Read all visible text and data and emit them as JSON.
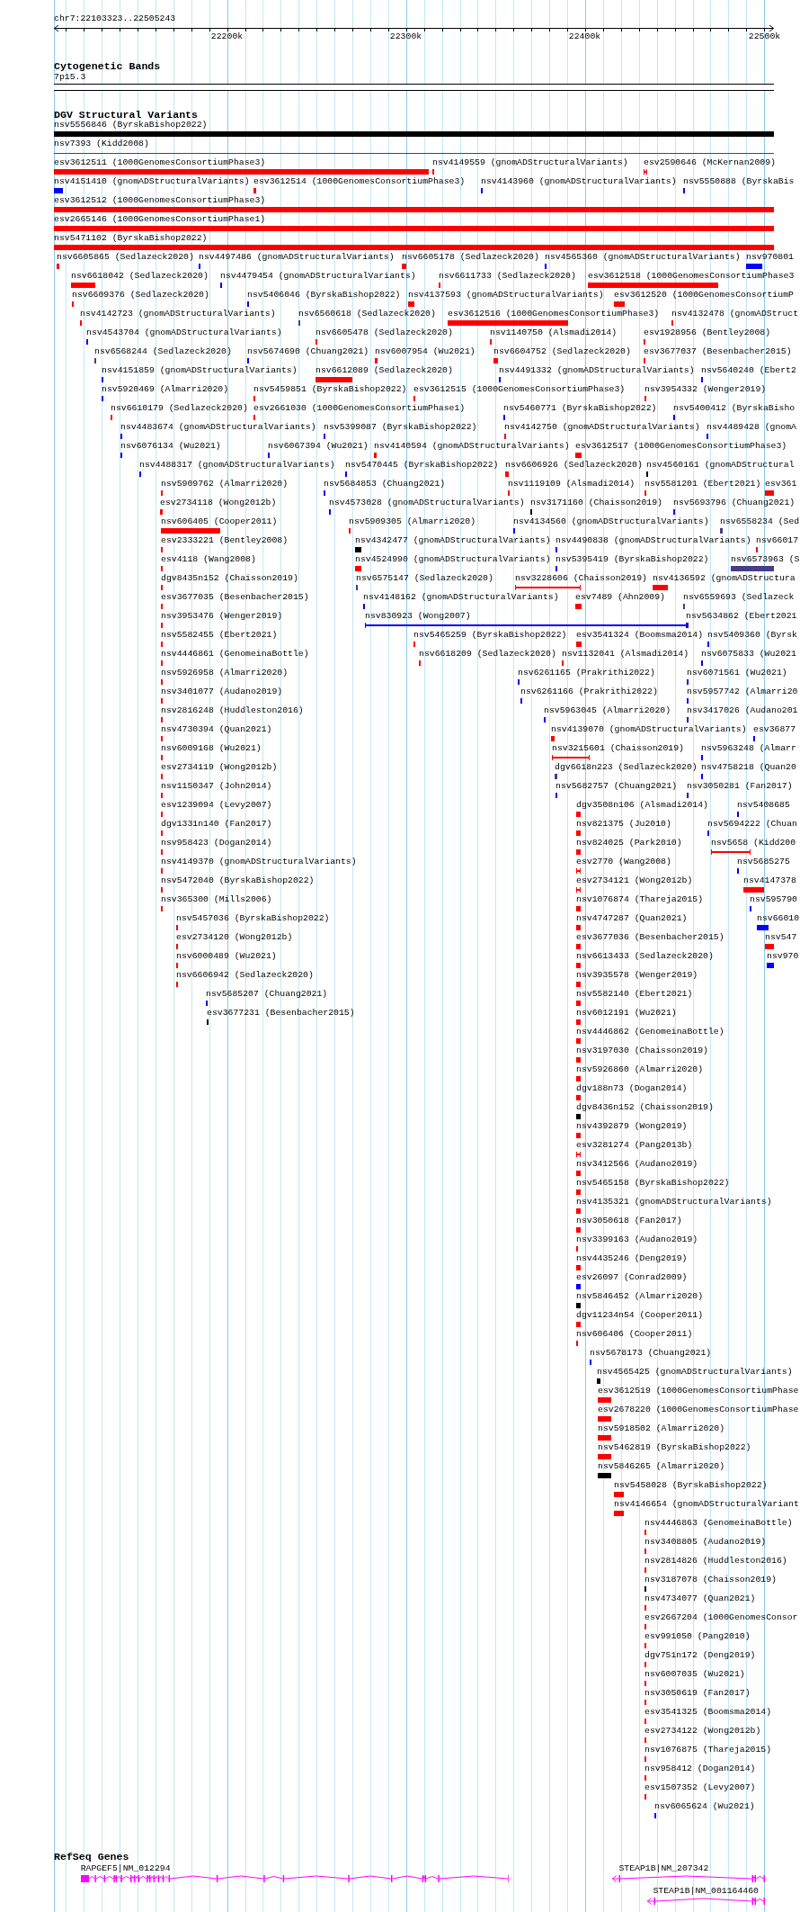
{
  "ruler": {
    "region": "chr7:22103323..22505243",
    "ticks": [
      "22200k",
      "22300k",
      "22400k",
      "22500k"
    ]
  },
  "cytogenetic_bands": {
    "title": "Cytogenetic Bands",
    "bands": [
      {
        "label": "7p15.3"
      }
    ]
  },
  "structural_variants": {
    "title": "DGV Structural Variants",
    "rows": [
      {
        "features": [
          {
            "label": "nsv5556846 (ByrskaBishop2022)",
            "color": "#000000",
            "kind": "block"
          }
        ]
      },
      {
        "features": [
          {
            "label": "nsv7393 (Kidd2008)",
            "color": "#483d8b",
            "kind": "line"
          }
        ]
      },
      {
        "features": [
          {
            "label": "esv3612511 (1000GenomesConsortiumPhase3)",
            "color": "#ff0000",
            "kind": "block"
          },
          {
            "label": "nsv4149559 (gnomADStructuralVariants)",
            "color": "#ff0000",
            "kind": "block"
          },
          {
            "label": "esv2590646 (McKernan2009)",
            "color": "#ff0000",
            "kind": "span"
          }
        ]
      },
      {
        "features": [
          {
            "label": "nsv4151410 (gnomADStructuralVariants)",
            "color": "#0000ff",
            "kind": "block"
          },
          {
            "label": "esv3612514 (1000GenomesConsortiumPhase3)",
            "color": "#ff0000",
            "kind": "block"
          },
          {
            "label": "nsv4143960 (gnomADStructuralVariants)",
            "color": "#0000ff",
            "kind": "block"
          },
          {
            "label": "nsv5550888 (ByrskaBis",
            "color": "#0000ff",
            "kind": "block"
          }
        ]
      },
      {
        "features": [
          {
            "label": "esv3612512 (1000GenomesConsortiumPhase3)",
            "color": "#ff0000",
            "kind": "block"
          }
        ]
      },
      {
        "features": [
          {
            "label": "esv2665146 (1000GenomesConsortiumPhase1)",
            "color": "#ff0000",
            "kind": "block"
          }
        ]
      },
      {
        "features": [
          {
            "label": "nsv5471102 (ByrskaBishop2022)",
            "color": "#ff0000",
            "kind": "block"
          }
        ]
      },
      {
        "features": [
          {
            "label": "nsv6605865 (Sedlazeck2020)",
            "color": "#ff0000",
            "kind": "block"
          },
          {
            "label": "nsv4497486 (gnomADStructuralVariants)",
            "color": "#0000ff",
            "kind": "block"
          },
          {
            "label": "nsv6605178 (Sedlazeck2020)",
            "color": "#ff0000",
            "kind": "block"
          },
          {
            "label": "nsv4565360 (gnomADStructuralVariants)",
            "color": "#0000ff",
            "kind": "block"
          },
          {
            "label": "nsv970801",
            "color": "#0000ff",
            "kind": "block"
          }
        ]
      },
      {
        "features": [
          {
            "label": "nsv6618042 (Sedlazeck2020)",
            "color": "#ff0000",
            "kind": "block"
          },
          {
            "label": "nsv4479454 (gnomADStructuralVariants)",
            "color": "#0000ff",
            "kind": "block"
          },
          {
            "label": "nsv6611733 (Sedlazeck2020)",
            "color": "#ff0000",
            "kind": "block"
          },
          {
            "label": "esv3612518 (1000GenomesConsortiumPhase3",
            "color": "#ff0000",
            "kind": "block"
          }
        ]
      },
      {
        "features": [
          {
            "label": "nsv6609376 (Sedlazeck2020)",
            "color": "#ff0000",
            "kind": "block"
          },
          {
            "label": "nsv5406046 (ByrskaBishop2022)",
            "color": "#0000ff",
            "kind": "block"
          },
          {
            "label": "nsv4137593 (gnomADStructuralVariants)",
            "color": "#ff0000",
            "kind": "block"
          },
          {
            "label": "esv3612520 (1000GenomesConsortiumP",
            "color": "#ff0000",
            "kind": "block"
          }
        ]
      },
      {
        "features": [
          {
            "label": "nsv4142723 (gnomADStructuralVariants)",
            "color": "#ff0000",
            "kind": "block"
          },
          {
            "label": "nsv6560618 (Sedlazeck2020)",
            "color": "#483d8b",
            "kind": "block"
          },
          {
            "label": "esv3612516 (1000GenomesConsortiumPhase3)",
            "color": "#ff0000",
            "kind": "block"
          },
          {
            "label": "nsv4132478 (gnomADStruct",
            "color": "#ff0000",
            "kind": "block"
          }
        ]
      },
      {
        "features": [
          {
            "label": "nsv4543704 (gnomADStructuralVariants)",
            "color": "#0000ff",
            "kind": "block"
          },
          {
            "label": "nsv6605478 (Sedlazeck2020)",
            "color": "#ff0000",
            "kind": "block"
          },
          {
            "label": "nsv1140750 (Alsmadi2014)",
            "color": "#ff0000",
            "kind": "block"
          },
          {
            "label": "esv1928956 (Bentley2008)",
            "color": "#ff0000",
            "kind": "block"
          }
        ]
      },
      {
        "features": [
          {
            "label": "nsv6568244 (Sedlazeck2020)",
            "color": "#483d8b",
            "kind": "block"
          },
          {
            "label": "nsv5674690 (Chuang2021)",
            "color": "#0000ff",
            "kind": "block"
          },
          {
            "label": "nsv6007954 (Wu2021)",
            "color": "#ff0000",
            "kind": "block"
          },
          {
            "label": "nsv6604752 (Sedlazeck2020)",
            "color": "#ff0000",
            "kind": "block"
          },
          {
            "label": "esv3677037 (Besenbacher2015)",
            "color": "#ff0000",
            "kind": "block"
          }
        ]
      },
      {
        "features": [
          {
            "label": "nsv4151859 (gnomADStructuralVariants)",
            "color": "#0000ff",
            "kind": "block"
          },
          {
            "label": "nsv6612089 (Sedlazeck2020)",
            "color": "#ff0000",
            "kind": "block"
          },
          {
            "label": "nsv4491332 (gnomADStructuralVariants)",
            "color": "#0000ff",
            "kind": "block"
          },
          {
            "label": "nsv5640240 (Ebert2",
            "color": "#0000ff",
            "kind": "block"
          }
        ]
      },
      {
        "features": [
          {
            "label": "nsv5920469 (Almarri2020)",
            "color": "#0000ff",
            "kind": "block"
          },
          {
            "label": "nsv5459851 (ByrskaBishop2022)",
            "color": "#ff0000",
            "kind": "block"
          },
          {
            "label": "esv3612515 (1000GenomesConsortiumPhase3)",
            "color": "#ff0000",
            "kind": "block"
          },
          {
            "label": "nsv3954332 (Wenger2019)",
            "color": "#ff0000",
            "kind": "block"
          }
        ]
      },
      {
        "features": [
          {
            "label": "nsv6610179 (Sedlazeck2020)",
            "color": "#ff0000",
            "kind": "block"
          },
          {
            "label": "esv2661030 (1000GenomesConsortiumPhase1)",
            "color": "#ff0000",
            "kind": "block"
          },
          {
            "label": "nsv5460771 (ByrskaBishop2022)",
            "color": "#0000ff",
            "kind": "block"
          },
          {
            "label": "nsv5400412 (ByrskaBisho",
            "color": "#0000ff",
            "kind": "block"
          }
        ]
      },
      {
        "features": [
          {
            "label": "nsv4483674 (gnomADStructuralVariants)",
            "color": "#0000ff",
            "kind": "block"
          },
          {
            "label": "nsv5399087 (ByrskaBishop2022)",
            "color": "#0000ff",
            "kind": "block"
          },
          {
            "label": "nsv4142750 (gnomADStructuralVariants)",
            "color": "#ff0000",
            "kind": "block"
          },
          {
            "label": "nsv4489428 (gnomA",
            "color": "#0000ff",
            "kind": "block"
          }
        ]
      },
      {
        "features": [
          {
            "label": "nsv6076134 (Wu2021)",
            "color": "#0000ff",
            "kind": "block"
          },
          {
            "label": "nsv6067394 (Wu2021)",
            "color": "#0000ff",
            "kind": "block"
          },
          {
            "label": "nsv4140594 (gnomADStructuralVariants)",
            "color": "#ff0000",
            "kind": "block"
          },
          {
            "label": "esv3612517 (1000GenomesConsortiumPhase3)",
            "color": "#ff0000",
            "kind": "block"
          }
        ]
      },
      {
        "features": [
          {
            "label": "nsv4488317 (gnomADStructuralVariants)",
            "color": "#0000ff",
            "kind": "block"
          },
          {
            "label": "nsv5470445 (ByrskaBishop2022)",
            "color": "#0000ff",
            "kind": "block"
          },
          {
            "label": "nsv6606926 (Sedlazeck2020)",
            "color": "#ff0000",
            "kind": "block"
          },
          {
            "label": "nsv4560161 (gnomADStructural",
            "color": "#000000",
            "kind": "block"
          }
        ]
      },
      {
        "features": [
          {
            "label": "nsv5909762 (Almarri2020)",
            "color": "#ff0000",
            "kind": "block"
          },
          {
            "label": "nsv5684853 (Chuang2021)",
            "color": "#0000ff",
            "kind": "block"
          },
          {
            "label": "nsv1119109 (Alsmadi2014)",
            "color": "#ff0000",
            "kind": "block"
          },
          {
            "label": "nsv5581201 (Ebert2021)",
            "color": "#ff0000",
            "kind": "block"
          },
          {
            "label": "esv361",
            "color": "#ff0000",
            "kind": "block"
          }
        ]
      },
      {
        "features": [
          {
            "label": "esv2734118 (Wong2012b)",
            "color": "#ff0000",
            "kind": "block"
          },
          {
            "label": "nsv4573028 (gnomADStructuralVariants)",
            "color": "#0000ff",
            "kind": "block"
          },
          {
            "label": "nsv3171160 (Chaisson2019)",
            "color": "#000000",
            "kind": "block"
          },
          {
            "label": "nsv5693796 (Chuang2021)",
            "color": "#0000ff",
            "kind": "block"
          }
        ]
      },
      {
        "features": [
          {
            "label": "nsv606405 (Cooper2011)",
            "color": "#ff0000",
            "kind": "block"
          },
          {
            "label": "nsv5909305 (Almarri2020)",
            "color": "#ff0000",
            "kind": "block"
          },
          {
            "label": "nsv4134560 (gnomADStructuralVariants)",
            "color": "#0000ff",
            "kind": "block"
          },
          {
            "label": "nsv6558234 (Sed",
            "color": "#483d8b",
            "kind": "block"
          }
        ]
      },
      {
        "features": [
          {
            "label": "esv2333221 (Bentley2008)",
            "color": "#ff0000",
            "kind": "block"
          },
          {
            "label": "nsv4342477 (gnomADStructuralVariants)",
            "color": "#000000",
            "kind": "block"
          },
          {
            "label": "nsv4490838 (gnomADStructuralVariants)",
            "color": "#0000ff",
            "kind": "block"
          },
          {
            "label": "nsv66017",
            "color": "#ff0000",
            "kind": "block"
          }
        ]
      },
      {
        "features": [
          {
            "label": "esv4118 (Wang2008)",
            "color": "#ff0000",
            "kind": "block"
          },
          {
            "label": "nsv4524990 (gnomADStructuralVariants)",
            "color": "#ff0000",
            "kind": "block"
          },
          {
            "label": "nsv5395419 (ByrskaBishop2022)",
            "color": "#0000ff",
            "kind": "block"
          },
          {
            "label": "nsv6573963 (S",
            "color": "#483d8b",
            "kind": "block"
          }
        ]
      },
      {
        "features": [
          {
            "label": "dgv8435n152 (Chaisson2019)",
            "color": "#ff0000",
            "kind": "block"
          },
          {
            "label": "nsv6575147 (Sedlazeck2020)",
            "color": "#483d8b",
            "kind": "block"
          },
          {
            "label": "nsv3228606 (Chaisson2019)",
            "color": "#ff0000",
            "kind": "span"
          },
          {
            "label": "nsv4136592 (gnomADStructura",
            "color": "#ff0000",
            "kind": "block"
          }
        ]
      },
      {
        "features": [
          {
            "label": "esv3677035 (Besenbacher2015)",
            "color": "#ff0000",
            "kind": "block"
          },
          {
            "label": "nsv4148162 (gnomADStructuralVariants)",
            "color": "#0000ff",
            "kind": "block"
          },
          {
            "label": "esv7489 (Ahn2009)",
            "color": "#ff0000",
            "kind": "block"
          },
          {
            "label": "nsv6559693 (Sedlazeck",
            "color": "#483d8b",
            "kind": "block"
          }
        ]
      },
      {
        "features": [
          {
            "label": "nsv3953476 (Wenger2019)",
            "color": "#ff0000",
            "kind": "block"
          },
          {
            "label": "nsv830923 (Wong2007)",
            "color": "#0000ff",
            "kind": "span"
          },
          {
            "label": "nsv5634862 (Ebert2021",
            "color": "#0000ff",
            "kind": "block"
          }
        ]
      },
      {
        "features": [
          {
            "label": "nsv5582455 (Ebert2021)",
            "color": "#ff0000",
            "kind": "block"
          },
          {
            "label": "nsv5465259 (ByrskaBishop2022)",
            "color": "#ff0000",
            "kind": "block"
          },
          {
            "label": "esv3541324 (Boomsma2014)",
            "color": "#ff0000",
            "kind": "block"
          },
          {
            "label": "nsv5409360 (Byrsk",
            "color": "#0000ff",
            "kind": "block"
          }
        ]
      },
      {
        "features": [
          {
            "label": "nsv4446861 (GenomeinaBottle)",
            "color": "#ff0000",
            "kind": "block"
          },
          {
            "label": "nsv6618209 (Sedlazeck2020)",
            "color": "#ff0000",
            "kind": "block"
          },
          {
            "label": "nsv1132041 (Alsmadi2014)",
            "color": "#ff0000",
            "kind": "block"
          },
          {
            "label": "nsv6075833 (Wu2021",
            "color": "#0000ff",
            "kind": "block"
          }
        ]
      },
      {
        "features": [
          {
            "label": "nsv5926958 (Almarri2020)",
            "color": "#ff0000",
            "kind": "block"
          },
          {
            "label": "nsv6261165 (Prakrithi2022)",
            "color": "#0000ff",
            "kind": "block"
          },
          {
            "label": "nsv6071561 (Wu2021)",
            "color": "#0000ff",
            "kind": "block"
          }
        ]
      },
      {
        "features": [
          {
            "label": "nsv3401077 (Audano2019)",
            "color": "#ff0000",
            "kind": "block"
          },
          {
            "label": "nsv6261166 (Prakrithi2022)",
            "color": "#0000ff",
            "kind": "block"
          },
          {
            "label": "nsv5957742 (Almarri20",
            "color": "#0000ff",
            "kind": "block"
          }
        ]
      },
      {
        "features": [
          {
            "label": "nsv2816248 (Huddleston2016)",
            "color": "#ff0000",
            "kind": "block"
          },
          {
            "label": "nsv5963045 (Almarri2020)",
            "color": "#0000ff",
            "kind": "block"
          },
          {
            "label": "nsv3417026 (Audano201",
            "color": "#0000ff",
            "kind": "block"
          }
        ]
      },
      {
        "features": [
          {
            "label": "nsv4730394 (Quan2021)",
            "color": "#ff0000",
            "kind": "block"
          },
          {
            "label": "nsv4139070 (gnomADStructuralVariants)",
            "color": "#ff0000",
            "kind": "block"
          },
          {
            "label": "esv36877",
            "color": "#0000ff",
            "kind": "block"
          }
        ]
      },
      {
        "features": [
          {
            "label": "nsv6009168 (Wu2021)",
            "color": "#ff0000",
            "kind": "block"
          },
          {
            "label": "nsv3215601 (Chaisson2019)",
            "color": "#ff0000",
            "kind": "span"
          },
          {
            "label": "nsv5963248 (Almarr",
            "color": "#0000ff",
            "kind": "block"
          }
        ]
      },
      {
        "features": [
          {
            "label": "esv2734119 (Wong2012b)",
            "color": "#ff0000",
            "kind": "block"
          },
          {
            "label": "dgv6618n223 (Sedlazeck2020)",
            "color": "#483d8b",
            "kind": "block"
          },
          {
            "label": "nsv4758218 (Quan20",
            "color": "#0000ff",
            "kind": "block"
          }
        ]
      },
      {
        "features": [
          {
            "label": "nsv1150347 (John2014)",
            "color": "#ff0000",
            "kind": "block"
          },
          {
            "label": "nsv5682757 (Chuang2021)",
            "color": "#0000ff",
            "kind": "block"
          },
          {
            "label": "nsv3050281 (Fan2017)",
            "color": "#0000ff",
            "kind": "block"
          }
        ]
      },
      {
        "features": [
          {
            "label": "esv1239094 (Levy2007)",
            "color": "#ff0000",
            "kind": "block"
          },
          {
            "label": "dgv3508n106 (Alsmadi2014)",
            "color": "#ff0000",
            "kind": "block"
          },
          {
            "label": "nsv5408685",
            "color": "#0000ff",
            "kind": "block"
          }
        ]
      },
      {
        "features": [
          {
            "label": "dgv1331n140 (Fan2017)",
            "color": "#ff0000",
            "kind": "block"
          },
          {
            "label": "nsv821375 (Ju2010)",
            "color": "#ff0000",
            "kind": "block"
          },
          {
            "label": "nsv5694222 (Chuan",
            "color": "#0000ff",
            "kind": "block"
          }
        ]
      },
      {
        "features": [
          {
            "label": "nsv958423 (Dogan2014)",
            "color": "#ff0000",
            "kind": "block"
          },
          {
            "label": "nsv824025 (Park2010)",
            "color": "#ff0000",
            "kind": "block"
          },
          {
            "label": "nsv5658 (Kidd200",
            "color": "#ff0000",
            "kind": "span"
          }
        ]
      },
      {
        "features": [
          {
            "label": "nsv4149370 (gnomADStructuralVariants)",
            "color": "#ff0000",
            "kind": "block"
          },
          {
            "label": "esv2770 (Wang2008)",
            "color": "#ff0000",
            "kind": "span"
          },
          {
            "label": "nsv5685275",
            "color": "#0000ff",
            "kind": "block"
          }
        ]
      },
      {
        "features": [
          {
            "label": "nsv5472040 (ByrskaBishop2022)",
            "color": "#ff0000",
            "kind": "block"
          },
          {
            "label": "esv2734121 (Wong2012b)",
            "color": "#ff0000",
            "kind": "span"
          },
          {
            "label": "nsv4147378",
            "color": "#ff0000",
            "kind": "block"
          }
        ]
      },
      {
        "features": [
          {
            "label": "nsv365300 (Mills2006)",
            "color": "#ff0000",
            "kind": "block"
          },
          {
            "label": "nsv1076874 (Thareja2015)",
            "color": "#ff0000",
            "kind": "block"
          },
          {
            "label": "nsv595790",
            "color": "#0000ff",
            "kind": "block"
          }
        ]
      },
      {
        "features": [
          {
            "label": "nsv5457036 (ByrskaBishop2022)",
            "color": "#ff0000",
            "kind": "block"
          },
          {
            "label": "nsv4747287 (Quan2021)",
            "color": "#ff0000",
            "kind": "block"
          },
          {
            "label": "nsv66010",
            "color": "#0000ff",
            "kind": "block"
          }
        ]
      },
      {
        "features": [
          {
            "label": "esv2734120 (Wong2012b)",
            "color": "#ff0000",
            "kind": "block"
          },
          {
            "label": "esv3677036 (Besenbacher2015)",
            "color": "#ff0000",
            "kind": "block"
          },
          {
            "label": "nsv547",
            "color": "#ff0000",
            "kind": "block"
          }
        ]
      },
      {
        "features": [
          {
            "label": "nsv6000489 (Wu2021)",
            "color": "#ff0000",
            "kind": "block"
          },
          {
            "label": "nsv6613433 (Sedlazeck2020)",
            "color": "#ff0000",
            "kind": "block"
          },
          {
            "label": "nsv970",
            "color": "#0000ff",
            "kind": "block"
          }
        ]
      },
      {
        "features": [
          {
            "label": "nsv6606942 (Sedlazeck2020)",
            "color": "#ff0000",
            "kind": "block"
          },
          {
            "label": "nsv3935578 (Wenger2019)",
            "color": "#ff0000",
            "kind": "block"
          }
        ]
      },
      {
        "features": [
          {
            "label": "nsv5685207 (Chuang2021)",
            "color": "#0000ff",
            "kind": "block"
          },
          {
            "label": "nsv5582140 (Ebert2021)",
            "color": "#ff0000",
            "kind": "block"
          }
        ]
      },
      {
        "features": [
          {
            "label": "esv3677231 (Besenbacher2015)",
            "color": "#000000",
            "kind": "block"
          },
          {
            "label": "nsv6012191 (Wu2021)",
            "color": "#ff0000",
            "kind": "block"
          }
        ]
      },
      {
        "features": [
          {
            "label": "nsv4446862 (GenomeinaBottle)",
            "color": "#ff0000",
            "kind": "block"
          }
        ]
      },
      {
        "features": [
          {
            "label": "nsv3197030 (Chaisson2019)",
            "color": "#ff0000",
            "kind": "block"
          }
        ]
      },
      {
        "features": [
          {
            "label": "nsv5926860 (Almarri2020)",
            "color": "#ff0000",
            "kind": "block"
          }
        ]
      },
      {
        "features": [
          {
            "label": "dgv188n73 (Dogan2014)",
            "color": "#ff0000",
            "kind": "block"
          }
        ]
      },
      {
        "features": [
          {
            "label": "dgv8436n152 (Chaisson2019)",
            "color": "#000000",
            "kind": "block"
          }
        ]
      },
      {
        "features": [
          {
            "label": "nsv4392879 (Wong2019)",
            "color": "#ff0000",
            "kind": "block"
          }
        ]
      },
      {
        "features": [
          {
            "label": "esv3281274 (Pang2013b)",
            "color": "#ff0000",
            "kind": "span"
          }
        ]
      },
      {
        "features": [
          {
            "label": "nsv3412566 (Audano2019)",
            "color": "#ff0000",
            "kind": "block"
          }
        ]
      },
      {
        "features": [
          {
            "label": "nsv5465158 (ByrskaBishop2022)",
            "color": "#ff0000",
            "kind": "block"
          }
        ]
      },
      {
        "features": [
          {
            "label": "nsv4135321 (gnomADStructuralVariants)",
            "color": "#ff0000",
            "kind": "block"
          }
        ]
      },
      {
        "features": [
          {
            "label": "nsv3050618 (Fan2017)",
            "color": "#ff0000",
            "kind": "block"
          }
        ]
      },
      {
        "features": [
          {
            "label": "nsv3399163 (Audano2019)",
            "color": "#ff0000",
            "kind": "block"
          }
        ]
      },
      {
        "features": [
          {
            "label": "nsv4435246 (Deng2019)",
            "color": "#ff0000",
            "kind": "block"
          }
        ]
      },
      {
        "features": [
          {
            "label": "esv26097 (Conrad2009)",
            "color": "#0000ff",
            "kind": "block"
          }
        ]
      },
      {
        "features": [
          {
            "label": "nsv5846452 (Almarri2020)",
            "color": "#000000",
            "kind": "block"
          }
        ]
      },
      {
        "features": [
          {
            "label": "dgv11234n54 (Cooper2011)",
            "color": "#ff0000",
            "kind": "block"
          }
        ]
      },
      {
        "features": [
          {
            "label": "nsv606406 (Cooper2011)",
            "color": "#ff0000",
            "kind": "block"
          }
        ]
      },
      {
        "features": [
          {
            "label": "nsv5678173 (Chuang2021)",
            "color": "#0000ff",
            "kind": "block"
          }
        ]
      },
      {
        "features": [
          {
            "label": "nsv4565425 (gnomADStructuralVariants)",
            "color": "#000000",
            "kind": "block"
          }
        ]
      },
      {
        "features": [
          {
            "label": "esv3612519 (1000GenomesConsortiumPhase",
            "color": "#ff0000",
            "kind": "block"
          }
        ]
      },
      {
        "features": [
          {
            "label": "esv2678220 (1000GenomesConsortiumPhase",
            "color": "#ff0000",
            "kind": "block"
          }
        ]
      },
      {
        "features": [
          {
            "label": "nsv5918502 (Almarri2020)",
            "color": "#ff0000",
            "kind": "block"
          }
        ]
      },
      {
        "features": [
          {
            "label": "nsv5462819 (ByrskaBishop2022)",
            "color": "#ff0000",
            "kind": "block"
          }
        ]
      },
      {
        "features": [
          {
            "label": "nsv5846265 (Almarri2020)",
            "color": "#000000",
            "kind": "block"
          }
        ]
      },
      {
        "features": [
          {
            "label": "nsv5458028 (ByrskaBishop2022)",
            "color": "#ff0000",
            "kind": "block"
          }
        ]
      },
      {
        "features": [
          {
            "label": "nsv4146654 (gnomADStructuralVariant",
            "color": "#ff0000",
            "kind": "block"
          }
        ]
      },
      {
        "features": [
          {
            "label": "nsv4446863 (GenomeinaBottle)",
            "color": "#ff0000",
            "kind": "block"
          }
        ]
      },
      {
        "features": [
          {
            "label": "nsv3408805 (Audano2019)",
            "color": "#ff0000",
            "kind": "block"
          }
        ]
      },
      {
        "features": [
          {
            "label": "nsv2814826 (Huddleston2016)",
            "color": "#ff0000",
            "kind": "block"
          }
        ]
      },
      {
        "features": [
          {
            "label": "nsv3187078 (Chaisson2019)",
            "color": "#000000",
            "kind": "block"
          }
        ]
      },
      {
        "features": [
          {
            "label": "nsv4734077 (Quan2021)",
            "color": "#ff0000",
            "kind": "block"
          }
        ]
      },
      {
        "features": [
          {
            "label": "esv2667204 (1000GenomesConsor",
            "color": "#ff0000",
            "kind": "block"
          }
        ]
      },
      {
        "features": [
          {
            "label": "esv991050 (Pang2010)",
            "color": "#ff0000",
            "kind": "block"
          }
        ]
      },
      {
        "features": [
          {
            "label": "dgv751n172 (Deng2019)",
            "color": "#ff0000",
            "kind": "block"
          }
        ]
      },
      {
        "features": [
          {
            "label": "nsv6007035 (Wu2021)",
            "color": "#ff0000",
            "kind": "block"
          }
        ]
      },
      {
        "features": [
          {
            "label": "nsv3050619 (Fan2017)",
            "color": "#ff0000",
            "kind": "block"
          }
        ]
      },
      {
        "features": [
          {
            "label": "esv3541325 (Boomsma2014)",
            "color": "#ff0000",
            "kind": "block"
          }
        ]
      },
      {
        "features": [
          {
            "label": "esv2734122 (Wong2012b)",
            "color": "#ff0000",
            "kind": "block"
          }
        ]
      },
      {
        "features": [
          {
            "label": "nsv1076875 (Thareja2015)",
            "color": "#ff0000",
            "kind": "block"
          }
        ]
      },
      {
        "features": [
          {
            "label": "nsv958412 (Dogan2014)",
            "color": "#ff0000",
            "kind": "block"
          }
        ]
      },
      {
        "features": [
          {
            "label": "esv1507352 (Levy2007)",
            "color": "#ff0000",
            "kind": "block"
          }
        ]
      },
      {
        "features": [
          {
            "label": "nsv6065624 (Wu2021)",
            "color": "#0000ff",
            "kind": "block"
          }
        ]
      }
    ]
  },
  "refseq_genes": {
    "title": "RefSeq Genes",
    "rows": [
      {
        "genes": [
          {
            "label": "RAPGEF5|NM_012294",
            "strand_arrow": false
          },
          {
            "label": "STEAP1B|NM_207342",
            "strand_arrow": true
          }
        ]
      },
      {
        "genes": [
          {
            "label": "STEAP1B|NM_001164460",
            "strand_arrow": true
          }
        ]
      }
    ]
  }
}
